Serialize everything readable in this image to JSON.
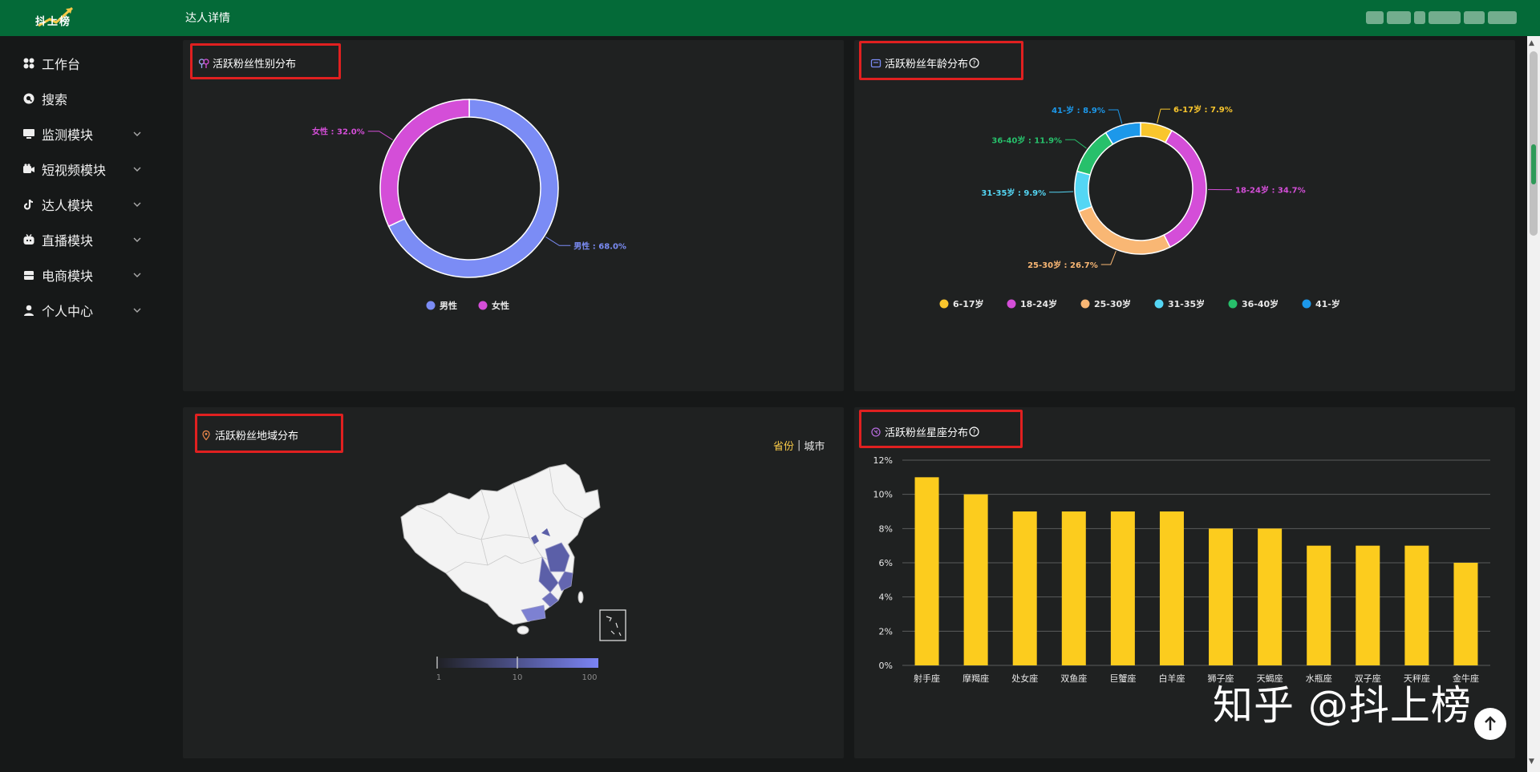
{
  "header": {
    "logo_text": "抖上榜",
    "page_title": "达人详情"
  },
  "sidebar": {
    "items": [
      {
        "label": "工作台",
        "icon": "grid-icon",
        "expandable": false
      },
      {
        "label": "搜索",
        "icon": "search-icon",
        "expandable": false
      },
      {
        "label": "监测模块",
        "icon": "monitor-icon",
        "expandable": true
      },
      {
        "label": "短视频模块",
        "icon": "video-icon",
        "expandable": true
      },
      {
        "label": "达人模块",
        "icon": "tiktok-icon",
        "expandable": true
      },
      {
        "label": "直播模块",
        "icon": "live-icon",
        "expandable": true
      },
      {
        "label": "电商模块",
        "icon": "shop-icon",
        "expandable": true
      },
      {
        "label": "个人中心",
        "icon": "user-icon",
        "expandable": true
      }
    ]
  },
  "panels": {
    "gender": {
      "title": "活跃粉丝性别分布",
      "icon": "gender-icon"
    },
    "age": {
      "title": "活跃粉丝年龄分布",
      "icon": "age-icon",
      "has_help": true
    },
    "region": {
      "title": "活跃粉丝地域分布",
      "icon": "location-icon",
      "toggle_active": "省份",
      "toggle_inactive": "城市",
      "scale_labels": [
        "1",
        "10",
        "100"
      ]
    },
    "constellation": {
      "title": "活跃粉丝星座分布",
      "icon": "constellation-icon",
      "has_help": true
    }
  },
  "colors": {
    "topbar": "#046a38",
    "male": "#7b8cf5",
    "female": "#d44ed8",
    "bar": "#fccc1e",
    "toggle_active": "#f7c948"
  },
  "chart_data": [
    {
      "type": "pie",
      "variant": "donut",
      "categories": [
        "男性",
        "女性"
      ],
      "values": [
        68.0,
        32.0
      ],
      "labels": [
        "男性 : 68.0%",
        "女性 : 32.0%"
      ],
      "colors": [
        "#7b8cf5",
        "#d44ed8"
      ],
      "legend": "bottom"
    },
    {
      "type": "pie",
      "variant": "donut",
      "categories": [
        "6-17岁",
        "18-24岁",
        "25-30岁",
        "31-35岁",
        "36-40岁",
        "41-岁"
      ],
      "values": [
        7.9,
        34.7,
        26.7,
        9.9,
        11.9,
        8.9
      ],
      "labels": [
        "6-17岁 : 7.9%",
        "18-24岁 : 34.7%",
        "25-30岁 : 26.7%",
        "31-35岁 : 9.9%",
        "36-40岁 : 11.9%",
        "41-岁 : 8.9%"
      ],
      "colors": [
        "#f9c62d",
        "#d44ed8",
        "#f9b774",
        "#54d6f4",
        "#27c06b",
        "#1c98ea"
      ],
      "legend": "bottom"
    },
    {
      "type": "bar",
      "categories": [
        "射手座",
        "摩羯座",
        "处女座",
        "双鱼座",
        "巨蟹座",
        "白羊座",
        "狮子座",
        "天蝎座",
        "水瓶座",
        "双子座",
        "天秤座",
        "金牛座"
      ],
      "values": [
        11,
        10,
        9,
        9,
        9,
        9,
        8,
        8,
        7,
        7,
        7,
        6
      ],
      "ylim": [
        0,
        12
      ],
      "yticks": [
        "0%",
        "2%",
        "4%",
        "6%",
        "8%",
        "10%",
        "12%"
      ],
      "grid": true
    }
  ],
  "watermark": "知乎 @抖上榜"
}
